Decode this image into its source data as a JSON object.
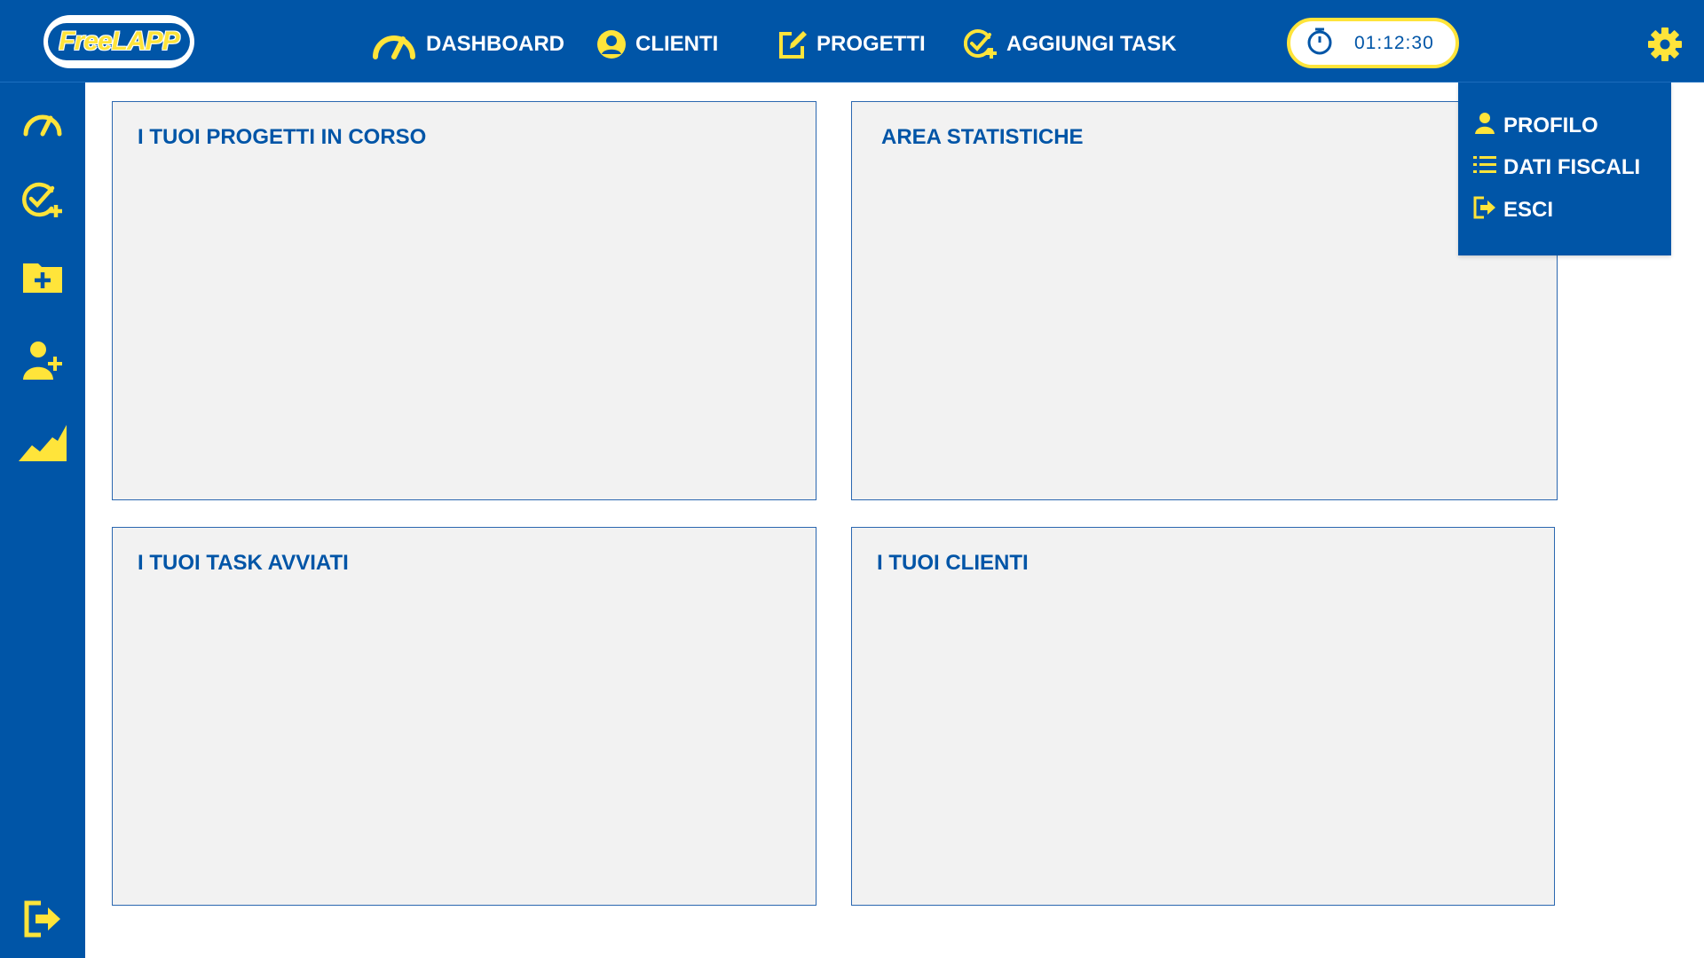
{
  "header": {
    "logo_text": "FreeLAPP",
    "nav": [
      {
        "label": "DASHBOARD",
        "icon": "speedometer-icon"
      },
      {
        "label": "CLIENTI",
        "icon": "user-circle-icon"
      },
      {
        "label": "PROGETTI",
        "icon": "edit-icon"
      },
      {
        "label": "AGGIUNGI TASK",
        "icon": "task-add-icon"
      }
    ],
    "timer": "01:12:30",
    "settings_icon": "gear-icon"
  },
  "sidebar": {
    "items": [
      {
        "icon": "speedometer-icon"
      },
      {
        "icon": "task-add-icon"
      },
      {
        "icon": "folder-add-icon"
      },
      {
        "icon": "user-add-icon"
      },
      {
        "icon": "chart-area-icon"
      }
    ],
    "bottom_icon": "logout-icon"
  },
  "panels": {
    "projects": {
      "title": "I TUOI PROGETTI IN CORSO"
    },
    "stats": {
      "title": "AREA STATISTICHE"
    },
    "tasks": {
      "title": "I TUOI TASK AVVIATI"
    },
    "clients": {
      "title": "I TUOI CLIENTI"
    }
  },
  "settings_menu": {
    "items": [
      {
        "label": "PROFILO",
        "icon": "user-icon"
      },
      {
        "label": "DATI FISCALI",
        "icon": "list-icon"
      },
      {
        "label": "ESCI",
        "icon": "logout-icon"
      }
    ]
  },
  "colors": {
    "primary": "#0055a7",
    "accent": "#ffe43a",
    "panel_bg": "#f2f2f2",
    "panel_border": "#2b67b0"
  }
}
